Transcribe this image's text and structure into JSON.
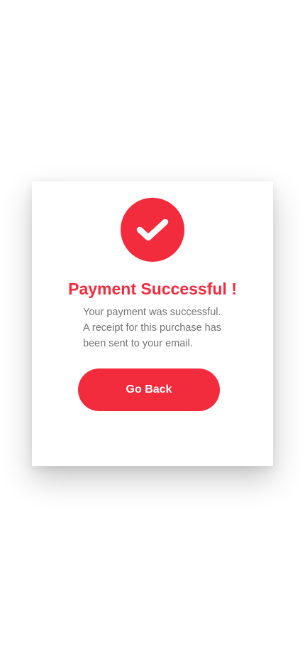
{
  "colors": {
    "accent": "#F22B3D",
    "text_muted": "#747474",
    "background": "#FFFFFF"
  },
  "dialog": {
    "icon": "check-icon",
    "title": "Payment Successful !",
    "message_lines": [
      "Your payment was successful.",
      "A receipt for this purchase has",
      "been sent to your email."
    ],
    "button_label": "Go Back"
  }
}
